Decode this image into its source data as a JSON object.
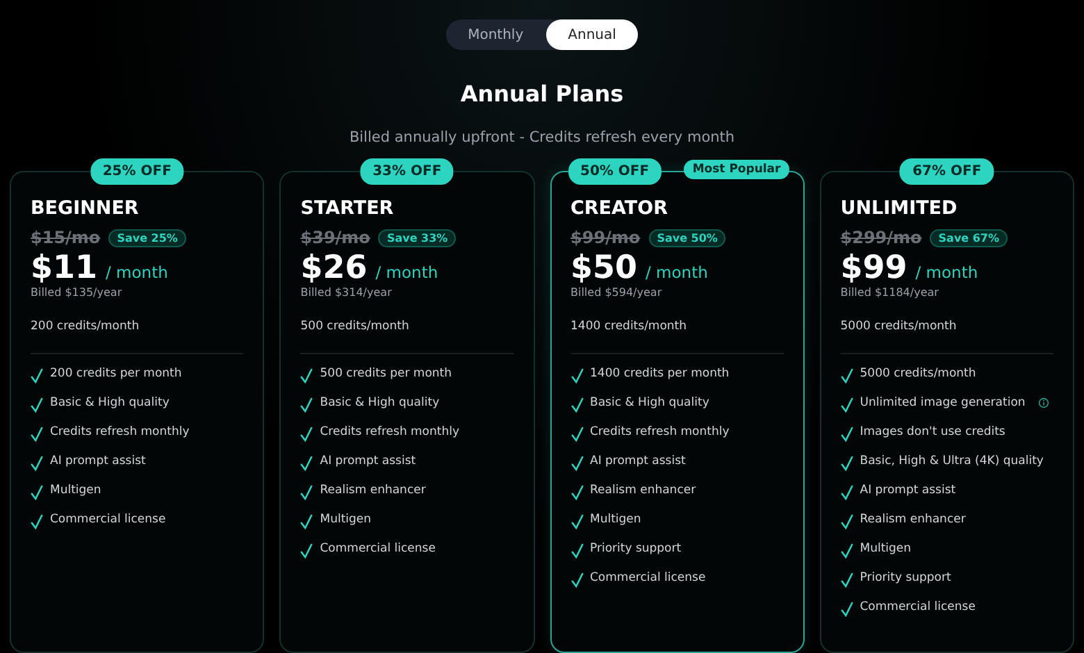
{
  "billing_toggle": [
    {
      "label": "Monthly",
      "selected": false
    },
    {
      "label": "Annual",
      "selected": true
    }
  ],
  "heading": "Annual Plans",
  "subheading": "Billed annually upfront - Credits refresh every month",
  "plans": [
    {
      "discount": "25% OFF",
      "featured": false,
      "name": "BEGINNER",
      "old_price": "$15/mo",
      "save": "Save 25%",
      "price": "$11",
      "period": "/ month",
      "billed": "Billed $135/year",
      "credits": "200 credits/month",
      "features": [
        {
          "text": "200 credits per month",
          "info": false
        },
        {
          "text": "Basic & High quality",
          "info": false
        },
        {
          "text": "Credits refresh monthly",
          "info": false
        },
        {
          "text": "AI prompt assist",
          "info": false
        },
        {
          "text": "Multigen",
          "info": false
        },
        {
          "text": "Commercial license",
          "info": false
        }
      ]
    },
    {
      "discount": "33% OFF",
      "featured": false,
      "name": "STARTER",
      "old_price": "$39/mo",
      "save": "Save 33%",
      "price": "$26",
      "period": "/ month",
      "billed": "Billed $314/year",
      "credits": "500 credits/month",
      "features": [
        {
          "text": "500 credits per month",
          "info": false
        },
        {
          "text": "Basic & High quality",
          "info": false
        },
        {
          "text": "Credits refresh monthly",
          "info": false
        },
        {
          "text": "AI prompt assist",
          "info": false
        },
        {
          "text": "Realism enhancer",
          "info": false
        },
        {
          "text": "Multigen",
          "info": false
        },
        {
          "text": "Commercial license",
          "info": false
        }
      ]
    },
    {
      "discount": "50% OFF",
      "featured": true,
      "popular_badge": "Most Popular",
      "name": "CREATOR",
      "old_price": "$99/mo",
      "save": "Save 50%",
      "price": "$50",
      "period": "/ month",
      "billed": "Billed $594/year",
      "credits": "1400 credits/month",
      "features": [
        {
          "text": "1400 credits per month",
          "info": false
        },
        {
          "text": "Basic & High quality",
          "info": false
        },
        {
          "text": "Credits refresh monthly",
          "info": false
        },
        {
          "text": "AI prompt assist",
          "info": false
        },
        {
          "text": "Realism enhancer",
          "info": false
        },
        {
          "text": "Multigen",
          "info": false
        },
        {
          "text": "Priority support",
          "info": false
        },
        {
          "text": "Commercial license",
          "info": false
        }
      ]
    },
    {
      "discount": "67% OFF",
      "featured": false,
      "name": "UNLIMITED",
      "old_price": "$299/mo",
      "save": "Save 67%",
      "price": "$99",
      "period": "/ month",
      "billed": "Billed $1184/year",
      "credits": "5000 credits/month",
      "features": [
        {
          "text": "5000 credits/month",
          "info": false
        },
        {
          "text": "Unlimited image generation",
          "info": true
        },
        {
          "text": "Images don't use credits",
          "info": false
        },
        {
          "text": "Basic, High & Ultra (4K) quality",
          "info": false
        },
        {
          "text": "AI prompt assist",
          "info": false
        },
        {
          "text": "Realism enhancer",
          "info": false
        },
        {
          "text": "Multigen",
          "info": false
        },
        {
          "text": "Priority support",
          "info": false
        },
        {
          "text": "Commercial license",
          "info": false
        }
      ]
    }
  ]
}
